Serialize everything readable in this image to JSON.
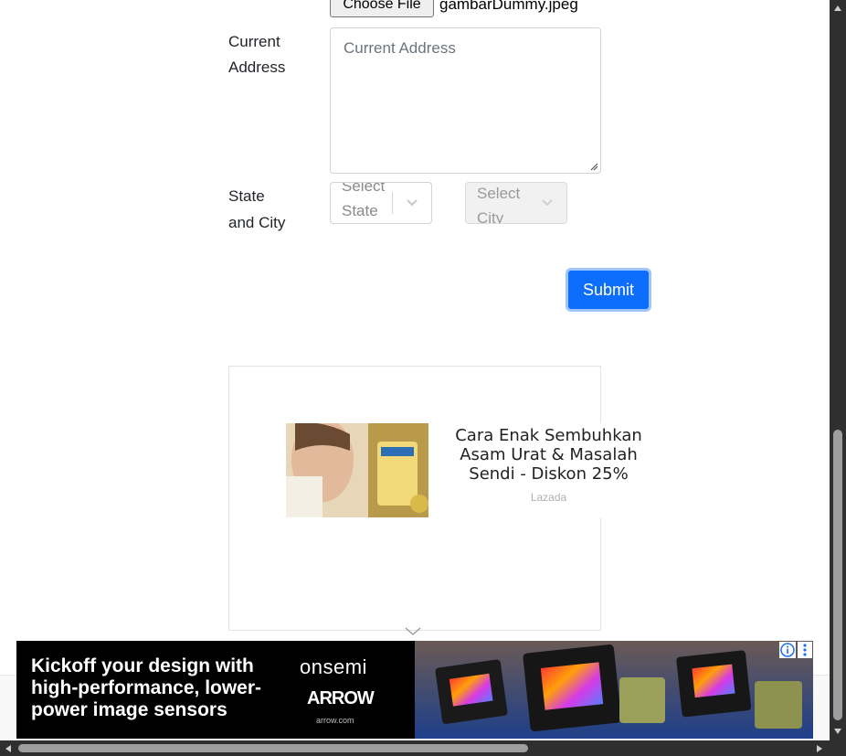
{
  "file_input": {
    "button_label": "Choose File",
    "file_name": "gambarDummy.jpeg"
  },
  "address": {
    "label": "Current Address",
    "placeholder": "Current Address"
  },
  "location": {
    "label_line1": "State",
    "label_line2": "and City",
    "state_placeholder": "Select State",
    "city_placeholder": "Select City"
  },
  "form": {
    "submit_label": "Submit"
  },
  "content_ad": {
    "title": "Cara Enak Sembuhkan Asam Urat & Masalah Sendi - Diskon 25%",
    "source": "Lazada"
  },
  "banner_ad": {
    "headline": "Kickoff your design with high-performance, lower-power image sensors",
    "brand_primary": "onsemi",
    "brand_secondary": "ARROW",
    "brand_url": "arrow.com"
  },
  "colors": {
    "primary": "#0d6efd",
    "banner_bg": "#000000",
    "scrollbar": "#2f2f2f"
  }
}
